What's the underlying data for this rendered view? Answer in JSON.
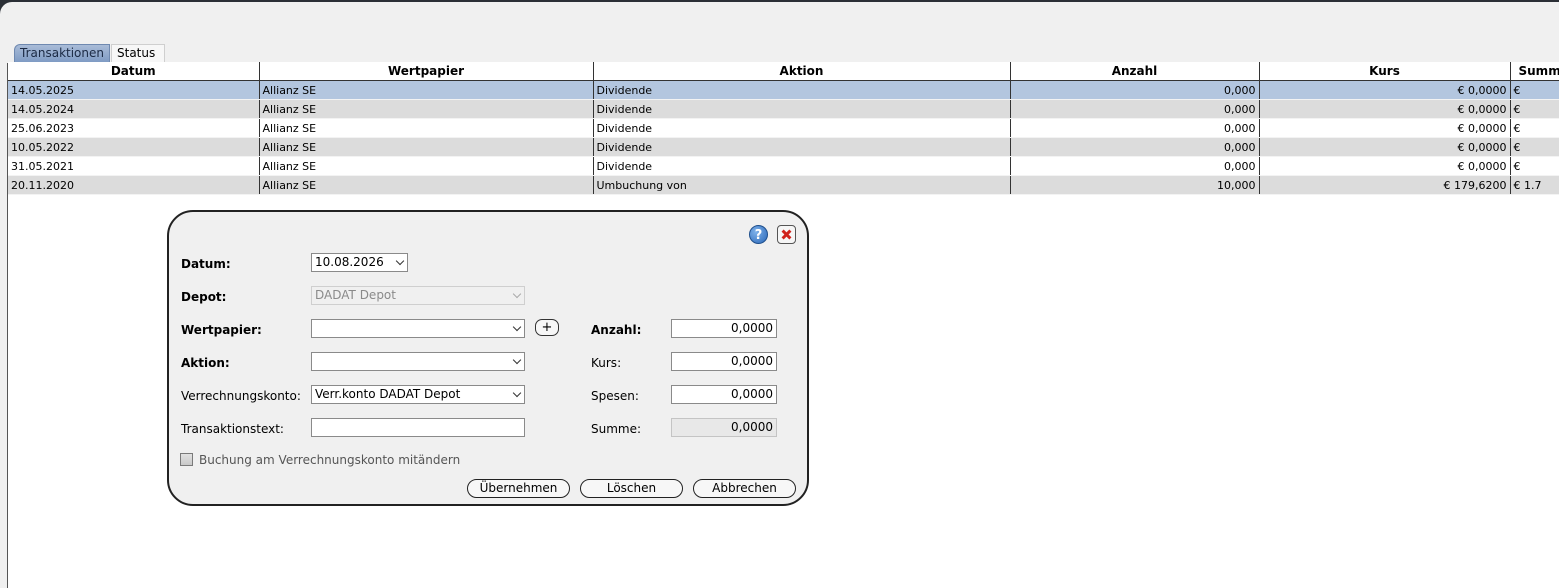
{
  "tabs": [
    {
      "label": "Transaktionen"
    },
    {
      "label": "Status"
    }
  ],
  "table": {
    "columns": [
      "Datum",
      "Wertpapier",
      "Aktion",
      "Anzahl",
      "Kurs",
      "Summ"
    ],
    "rows": [
      {
        "datum": "14.05.2025",
        "wertpapier": "Allianz SE",
        "aktion": "Dividende",
        "anzahl": "0,000",
        "kurs": "€ 0,0000",
        "summe": "€"
      },
      {
        "datum": "14.05.2024",
        "wertpapier": "Allianz SE",
        "aktion": "Dividende",
        "anzahl": "0,000",
        "kurs": "€ 0,0000",
        "summe": "€"
      },
      {
        "datum": "25.06.2023",
        "wertpapier": "Allianz SE",
        "aktion": "Dividende",
        "anzahl": "0,000",
        "kurs": "€ 0,0000",
        "summe": "€"
      },
      {
        "datum": "10.05.2022",
        "wertpapier": "Allianz SE",
        "aktion": "Dividende",
        "anzahl": "0,000",
        "kurs": "€ 0,0000",
        "summe": "€"
      },
      {
        "datum": "31.05.2021",
        "wertpapier": "Allianz SE",
        "aktion": "Dividende",
        "anzahl": "0,000",
        "kurs": "€ 0,0000",
        "summe": "€"
      },
      {
        "datum": "20.11.2020",
        "wertpapier": "Allianz SE",
        "aktion": "Umbuchung von",
        "anzahl": "10,000",
        "kurs": "€ 179,6200",
        "summe": "€ 1.7"
      }
    ]
  },
  "dialog": {
    "datum_label": "Datum:",
    "datum_value": "10.08.2026",
    "depot_label": "Depot:",
    "depot_value": "DADAT Depot",
    "wertpapier_label": "Wertpapier:",
    "wertpapier_value": "",
    "add_label": "+",
    "aktion_label": "Aktion:",
    "aktion_value": "",
    "verrechnungskonto_label": "Verrechnungskonto:",
    "verrechnungskonto_value": "Verr.konto DADAT Depot",
    "transaktionstext_label": "Transaktionstext:",
    "transaktionstext_value": "",
    "anzahl_label": "Anzahl:",
    "anzahl_value": "0,0000",
    "kurs_label": "Kurs:",
    "kurs_value": "0,0000",
    "spesen_label": "Spesen:",
    "spesen_value": "0,0000",
    "summe_label": "Summe:",
    "summe_value": "0,0000",
    "help_label": "?",
    "checkbox_label": "Buchung am Verrechnungskonto mitändern",
    "btn_uebernehmen": "Übernehmen",
    "btn_loeschen": "Löschen",
    "btn_abbrechen": "Abbrechen"
  }
}
